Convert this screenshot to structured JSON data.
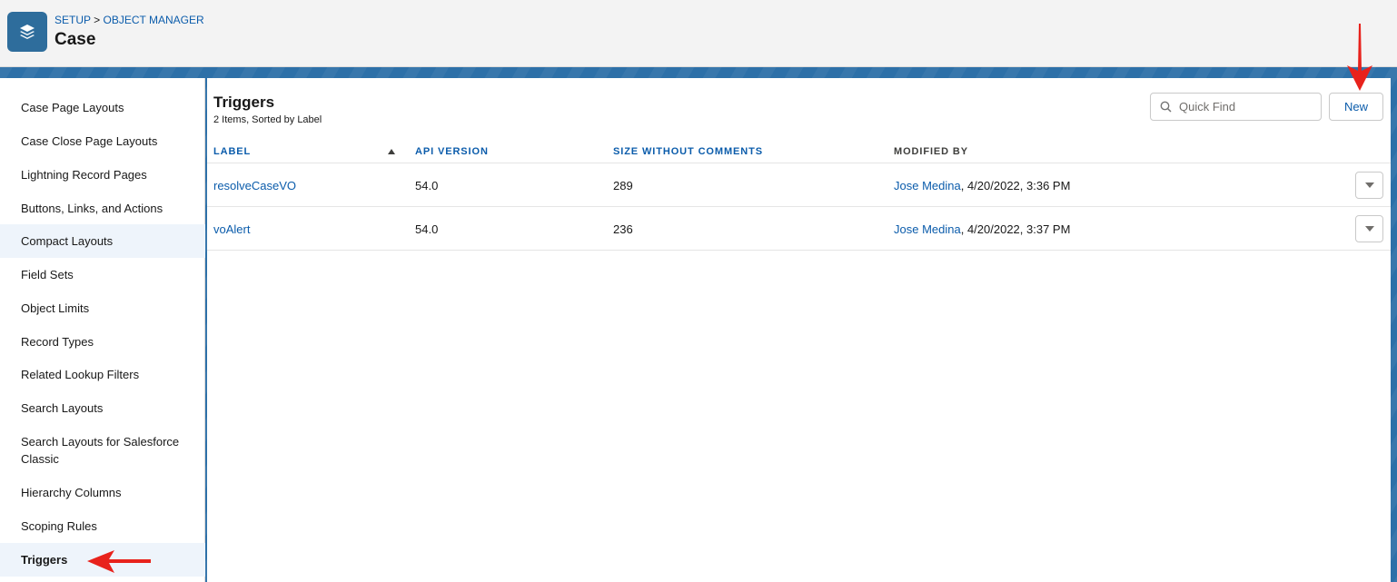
{
  "header": {
    "breadcrumb_setup": "SETUP",
    "breadcrumb_sep": ">",
    "breadcrumb_object_manager": "OBJECT MANAGER",
    "title": "Case"
  },
  "sidebar": {
    "items": [
      {
        "label": "Case Page Layouts"
      },
      {
        "label": "Case Close Page Layouts"
      },
      {
        "label": "Lightning Record Pages"
      },
      {
        "label": "Buttons, Links, and Actions"
      },
      {
        "label": "Compact Layouts"
      },
      {
        "label": "Field Sets"
      },
      {
        "label": "Object Limits"
      },
      {
        "label": "Record Types"
      },
      {
        "label": "Related Lookup Filters"
      },
      {
        "label": "Search Layouts"
      },
      {
        "label": "Search Layouts for Salesforce Classic"
      },
      {
        "label": "Hierarchy Columns"
      },
      {
        "label": "Scoping Rules"
      },
      {
        "label": "Triggers"
      }
    ],
    "active_index": 13
  },
  "main": {
    "title": "Triggers",
    "subtitle": "2 Items, Sorted by Label",
    "quick_find_placeholder": "Quick Find",
    "new_button": "New",
    "columns": [
      "LABEL",
      "API VERSION",
      "SIZE WITHOUT COMMENTS",
      "MODIFIED BY"
    ],
    "rows": [
      {
        "label": "resolveCaseVO",
        "api_version": "54.0",
        "size": "289",
        "modified_by_name": "Jose Medina",
        "modified_by_date": ", 4/20/2022, 3:36 PM"
      },
      {
        "label": "voAlert",
        "api_version": "54.0",
        "size": "236",
        "modified_by_name": "Jose Medina",
        "modified_by_date": ", 4/20/2022, 3:37 PM"
      }
    ]
  },
  "icons": {
    "object_icon": "layers-icon",
    "search": "search-icon",
    "sort": "sort-ascending-icon",
    "row_menu": "chevron-down-icon",
    "annotation": "red-arrow-icon"
  },
  "colors": {
    "link": "#0b5cab",
    "object_icon_bg": "#2e6d9c",
    "band": "#2d70a8",
    "annotation_arrow": "#e8221c"
  }
}
